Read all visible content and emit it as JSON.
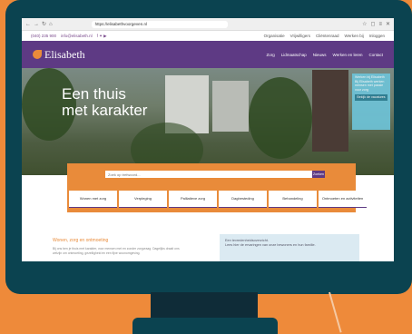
{
  "browser": {
    "url": "https://elisabethvoorgeven.nl"
  },
  "topbar": {
    "phone": "(040) 235 900",
    "email": "info@elisabeth.nl",
    "links": [
      "Organisatie",
      "Vrijwilligers",
      "Cliëntenraad",
      "Werken bij",
      "Inloggen"
    ]
  },
  "nav": {
    "logo": "Elisabeth",
    "links": [
      "Zorg",
      "Lidmaatschap",
      "Nieuws",
      "Werken en leren",
      "Contact"
    ]
  },
  "hero": {
    "title_line1": "Een thuis",
    "title_line2": "met karakter",
    "widget": {
      "title": "Werken bij Elisabeth",
      "body": "Bij Elisabeth werken mensen met passie voor zorg",
      "button": "Bekijk de vacatures"
    }
  },
  "search": {
    "placeholder": "Zoek op trefwoord...",
    "button": "Zoeken"
  },
  "tiles": [
    "Wonen met zorg",
    "Verpleging",
    "Palliatieve zorg",
    "Dagbesteding",
    "Behandeling",
    "Ontmoeten en activiteiten"
  ],
  "content": {
    "heading": "Wonen, zorg en ontmoeting",
    "text": "Bij ons ben je thuis met karakter, voor mensen met en zonder zorgvraag. Dagelijks draait ons welzijn om ontmoeting, gezelligheid en een fijne woonomgeving.",
    "quote_title": "Een tevredenheidsoverzicht.",
    "quote_text": "Lees hier de ervaringen van onze bewoners en hun familie."
  }
}
